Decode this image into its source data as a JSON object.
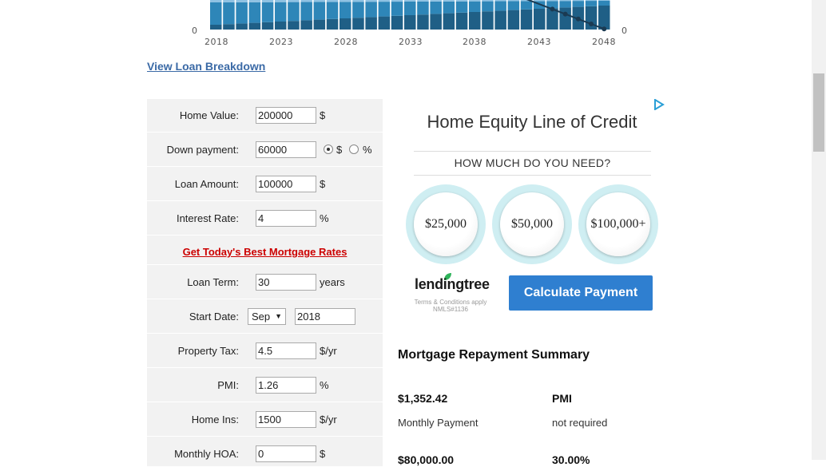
{
  "chart_data": {
    "type": "bar",
    "x_tick_labels": [
      "2018",
      "2023",
      "2028",
      "2033",
      "2038",
      "2043",
      "2048"
    ],
    "left_axis_min_label": "0",
    "right_axis_min_label": "0",
    "colors": {
      "dark": "#1f5f86",
      "mid": "#2e86b8",
      "light": "#8fc2e3",
      "line": "#1b3a52"
    },
    "note": "visible portion only; stacked bars of principal vs interest by year, balance line"
  },
  "links": {
    "view_breakdown": "View Loan Breakdown",
    "best_rates": "Get Today's Best Mortgage Rates"
  },
  "form": {
    "home_value": {
      "label": "Home Value:",
      "value": "200000",
      "unit": "$"
    },
    "down_payment": {
      "label": "Down payment:",
      "value": "60000",
      "unit_dollar": "$",
      "unit_percent": "%",
      "selected": "$"
    },
    "loan_amount": {
      "label": "Loan Amount:",
      "value": "100000",
      "unit": "$"
    },
    "interest_rate": {
      "label": "Interest Rate:",
      "value": "4",
      "unit": "%"
    },
    "loan_term": {
      "label": "Loan Term:",
      "value": "30",
      "unit": "years"
    },
    "start_date": {
      "label": "Start Date:",
      "month": "Sep",
      "year": "2018"
    },
    "property_tax": {
      "label": "Property Tax:",
      "value": "4.5",
      "unit": "$/yr"
    },
    "pmi": {
      "label": "PMI:",
      "value": "1.26",
      "unit": "%"
    },
    "home_ins": {
      "label": "Home Ins:",
      "value": "1500",
      "unit": "$/yr"
    },
    "monthly_hoa": {
      "label": "Monthly HOA:",
      "value": "0",
      "unit": "$"
    }
  },
  "ad": {
    "title": "Home Equity Line of Credit",
    "question": "HOW MUCH DO YOU NEED?",
    "amounts": [
      "$25,000",
      "$50,000",
      "$100,000+"
    ],
    "brand": "lendingtree",
    "terms_line1": "Terms & Conditions apply",
    "terms_line2": "NMLS#1136",
    "button": "Calculate Payment",
    "accent": "#2f7fd0"
  },
  "summary": {
    "title": "Mortgage Repayment Summary",
    "monthly_payment_value": "$1,352.42",
    "monthly_payment_label": "Monthly Payment",
    "pmi_value": "PMI",
    "pmi_label": "not required",
    "cut_left": "$80,000.00",
    "cut_right": "30.00%"
  }
}
